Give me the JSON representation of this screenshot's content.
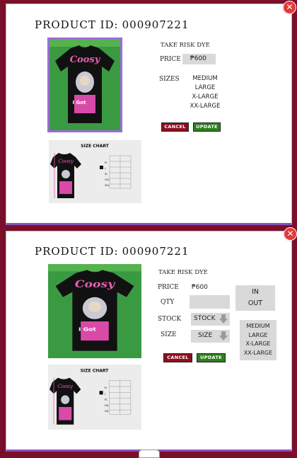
{
  "modal_top": {
    "title_label": "PRODUCT ID:",
    "product_id": "000907221",
    "product_name": "TAKE RISK DYE",
    "price_label": "PRICE",
    "price_value": "₱600",
    "sizes_label": "SIZES",
    "sizes": [
      "MEDIUM",
      "LARGE",
      "X-LARGE",
      "XX-LARGE"
    ],
    "cancel_label": "CANCEL",
    "update_label": "UPDATE"
  },
  "modal_bottom": {
    "title_label": "PRODUCT ID:",
    "product_id": "000907221",
    "product_name": "TAKE RISK DYE",
    "price_label": "PRICE",
    "price_value": "₱600",
    "qty_label": "QTY",
    "qty_value": "",
    "stock_label": "STOCK",
    "stock_select": "STOCK",
    "size_label": "SIZE",
    "size_select": "SIZE",
    "in_label": "IN",
    "out_label": "OUT",
    "sizes": [
      "MEDIUM",
      "LARGE",
      "X-LARGE",
      "XX-LARGE"
    ],
    "cancel_label": "CANCEL",
    "update_label": "UPDATE"
  },
  "artwork": {
    "shirt_text": "Coosy",
    "shirt_text2": "I Got",
    "chart_title": "SIZE CHART",
    "chart_rows": [
      "M",
      "L",
      "XL",
      "2XL",
      "3XL"
    ]
  },
  "colors": {
    "background": "#7a0f2a",
    "cancel": "#8c0f1f",
    "update": "#2e7d1f",
    "close": "#e03a3a",
    "image_border": "#9b6bd8"
  },
  "icons": [
    "close-icon",
    "dropdown-arrow-icon"
  ]
}
